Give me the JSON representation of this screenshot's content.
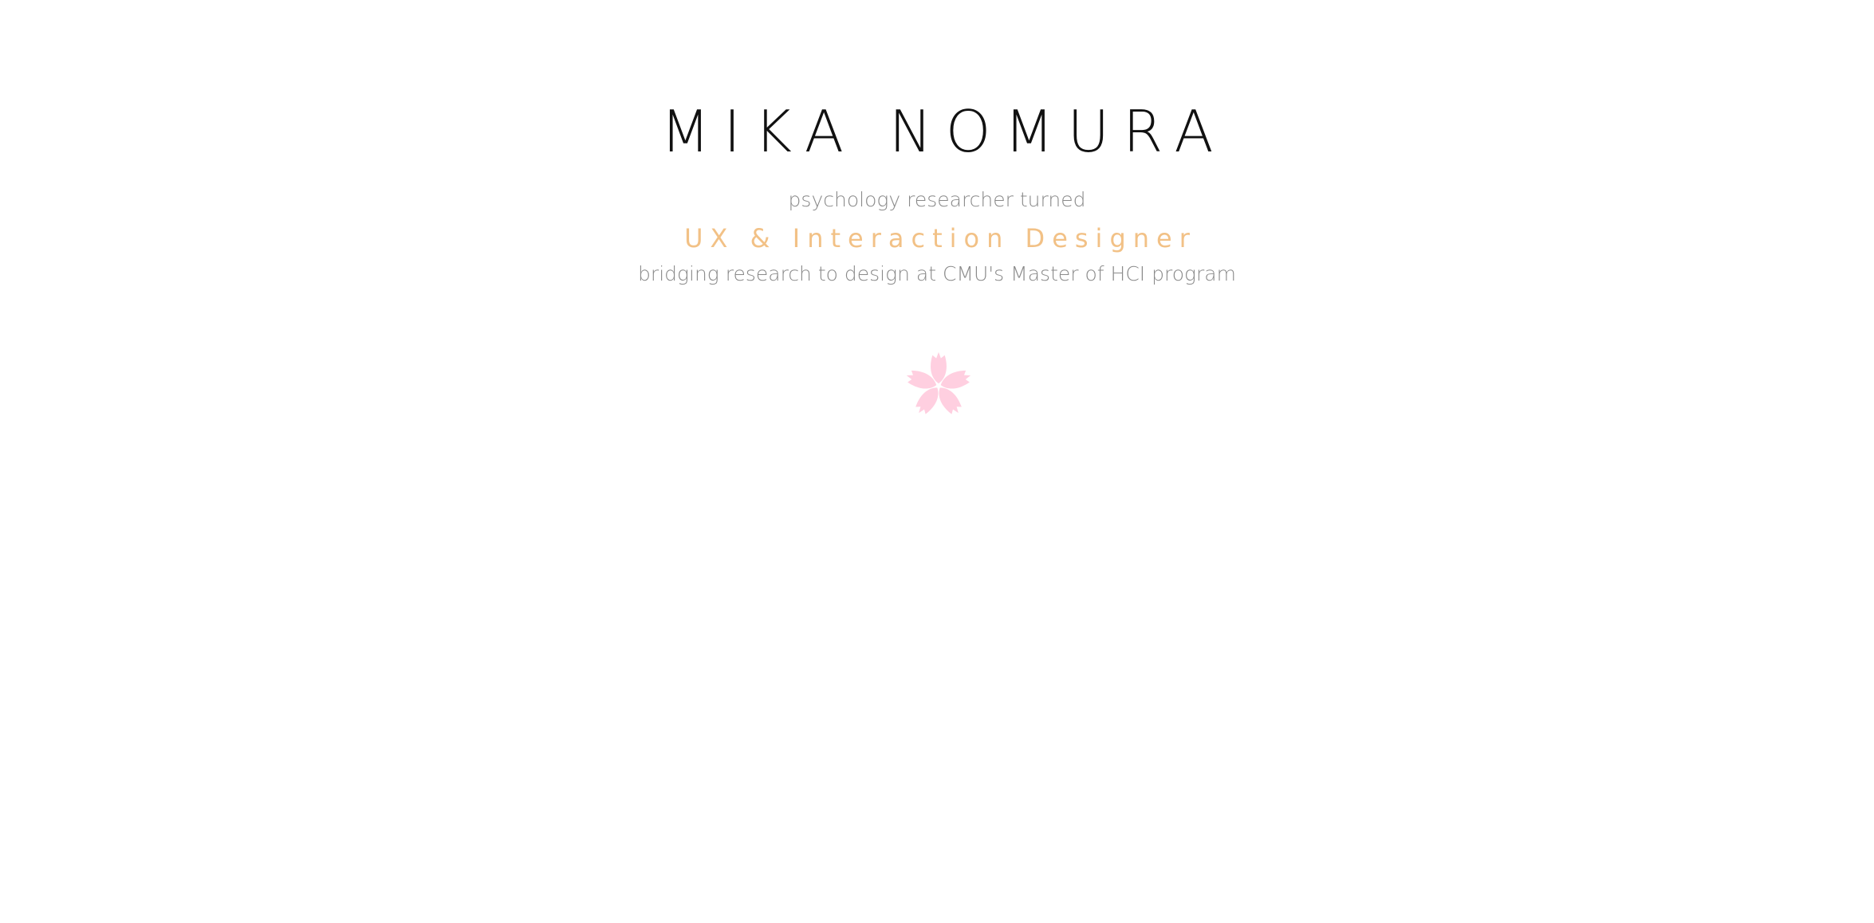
{
  "hero": {
    "name": "MIKA NOMURA",
    "intro": "psychology researcher turned",
    "role": "UX & Interaction Designer",
    "tagline": "bridging research to design at CMU's Master of HCI program",
    "flower_icon": "cherry-blossom-icon"
  },
  "colors": {
    "name": "#111111",
    "subtitle": "#8a8a8a",
    "accent": "#f2c186",
    "blossom": "#ffcfe0",
    "background": "#ffffff"
  }
}
